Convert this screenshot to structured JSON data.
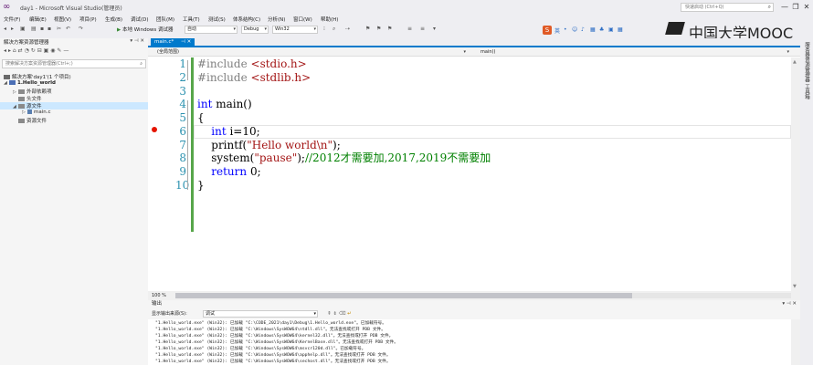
{
  "window": {
    "title": "day1 - Microsoft Visual Studio(管理员)",
    "quick_launch_placeholder": "快速启动 (Ctrl+Q)",
    "minimize": "—",
    "restore": "❐",
    "close": "✕"
  },
  "menu": [
    "文件(F)",
    "编辑(E)",
    "视图(V)",
    "项目(P)",
    "生成(B)",
    "调试(D)",
    "团队(M)",
    "工具(T)",
    "测试(S)",
    "体系结构(C)",
    "分析(N)",
    "窗口(W)",
    "帮助(H)"
  ],
  "toolbar": {
    "run_label": "本地 Windows 调试器",
    "run_mode": "自动",
    "config": "Debug",
    "platform": "Win32"
  },
  "mooc": {
    "text": "中国大学MOOC"
  },
  "solution_explorer": {
    "title": "解决方案资源管理器",
    "search_placeholder": "搜索解决方案资源管理器(Ctrl+;)",
    "items": [
      {
        "label": "解决方案'day1'(1 个项目)",
        "level": 0,
        "expander": ""
      },
      {
        "label": "1.Hello_world",
        "level": 1,
        "expander": "◢"
      },
      {
        "label": "外部依赖项",
        "level": 2,
        "expander": "▷"
      },
      {
        "label": "头文件",
        "level": 2,
        "expander": ""
      },
      {
        "label": "源文件",
        "level": 2,
        "expander": "◢"
      },
      {
        "label": "main.c",
        "level": 3,
        "expander": "▷"
      },
      {
        "label": "资源文件",
        "level": 2,
        "expander": ""
      }
    ]
  },
  "editor": {
    "tab_label": "main.c*",
    "tab_pin": "⊣",
    "tab_close": "✕",
    "scope_combo": "(全局范围)",
    "function_combo": "main()",
    "zoom": "100 %",
    "line_numbers": [
      "1",
      "2",
      "3",
      "4",
      "5",
      "6",
      "7",
      "8",
      "9",
      "10"
    ],
    "breakpoint_line": 6,
    "lines": [
      {
        "t1": "#include ",
        "t2": "<stdio.h>"
      },
      {
        "t1": "#include ",
        "t2": "<stdlib.h>"
      },
      {
        "t1": ""
      },
      {
        "kw": "int",
        "t1": " main()"
      },
      {
        "t1": "{"
      },
      {
        "indent": "    ",
        "kw": "int",
        "t1": " i=10;"
      },
      {
        "indent": "    ",
        "t1": "printf(",
        "str": "\"Hello world\\n\"",
        "t2": ");"
      },
      {
        "indent": "    ",
        "t1": "system(",
        "str": "\"pause\"",
        "t2": ");",
        "com": "//2012才需要加,2017,2019不需要加"
      },
      {
        "indent": "    ",
        "kw": "return",
        "t1": " 0;"
      },
      {
        "t1": "}"
      }
    ]
  },
  "output": {
    "title": "输出",
    "source_label": "显示输出来源(S):",
    "source_value": "调试",
    "lines": [
      "\"1.Hello_world.exe\" (Win32): 已加载 \"C:\\CODE_2021\\day1\\Debug\\1.Hello_world.exe\"。已加载符号。",
      "\"1.Hello_world.exe\" (Win32): 已加载 \"C:\\Windows\\SysWOW64\\ntdll.dll\"。无法查找或打开 PDB 文件。",
      "\"1.Hello_world.exe\" (Win32): 已加载 \"C:\\Windows\\SysWOW64\\kernel32.dll\"。无法查找或打开 PDB 文件。",
      "\"1.Hello_world.exe\" (Win32): 已加载 \"C:\\Windows\\SysWOW64\\KernelBase.dll\"。无法查找或打开 PDB 文件。",
      "\"1.Hello_world.exe\" (Win32): 已加载 \"C:\\Windows\\SysWOW64\\msvcr120d.dll\"。已加载符号。",
      "\"1.Hello_world.exe\" (Win32): 已加载 \"C:\\Windows\\SysWOW64\\apphelp.dll\"。无法查找或打开 PDB 文件。",
      "\"1.Hello_world.exe\" (Win32): 已加载 \"C:\\Windows\\SysWOW64\\sechost.dll\"。无法查找或打开 PDB 文件。"
    ]
  },
  "right_rail": [
    "服务器资源管理器",
    "工具箱"
  ]
}
